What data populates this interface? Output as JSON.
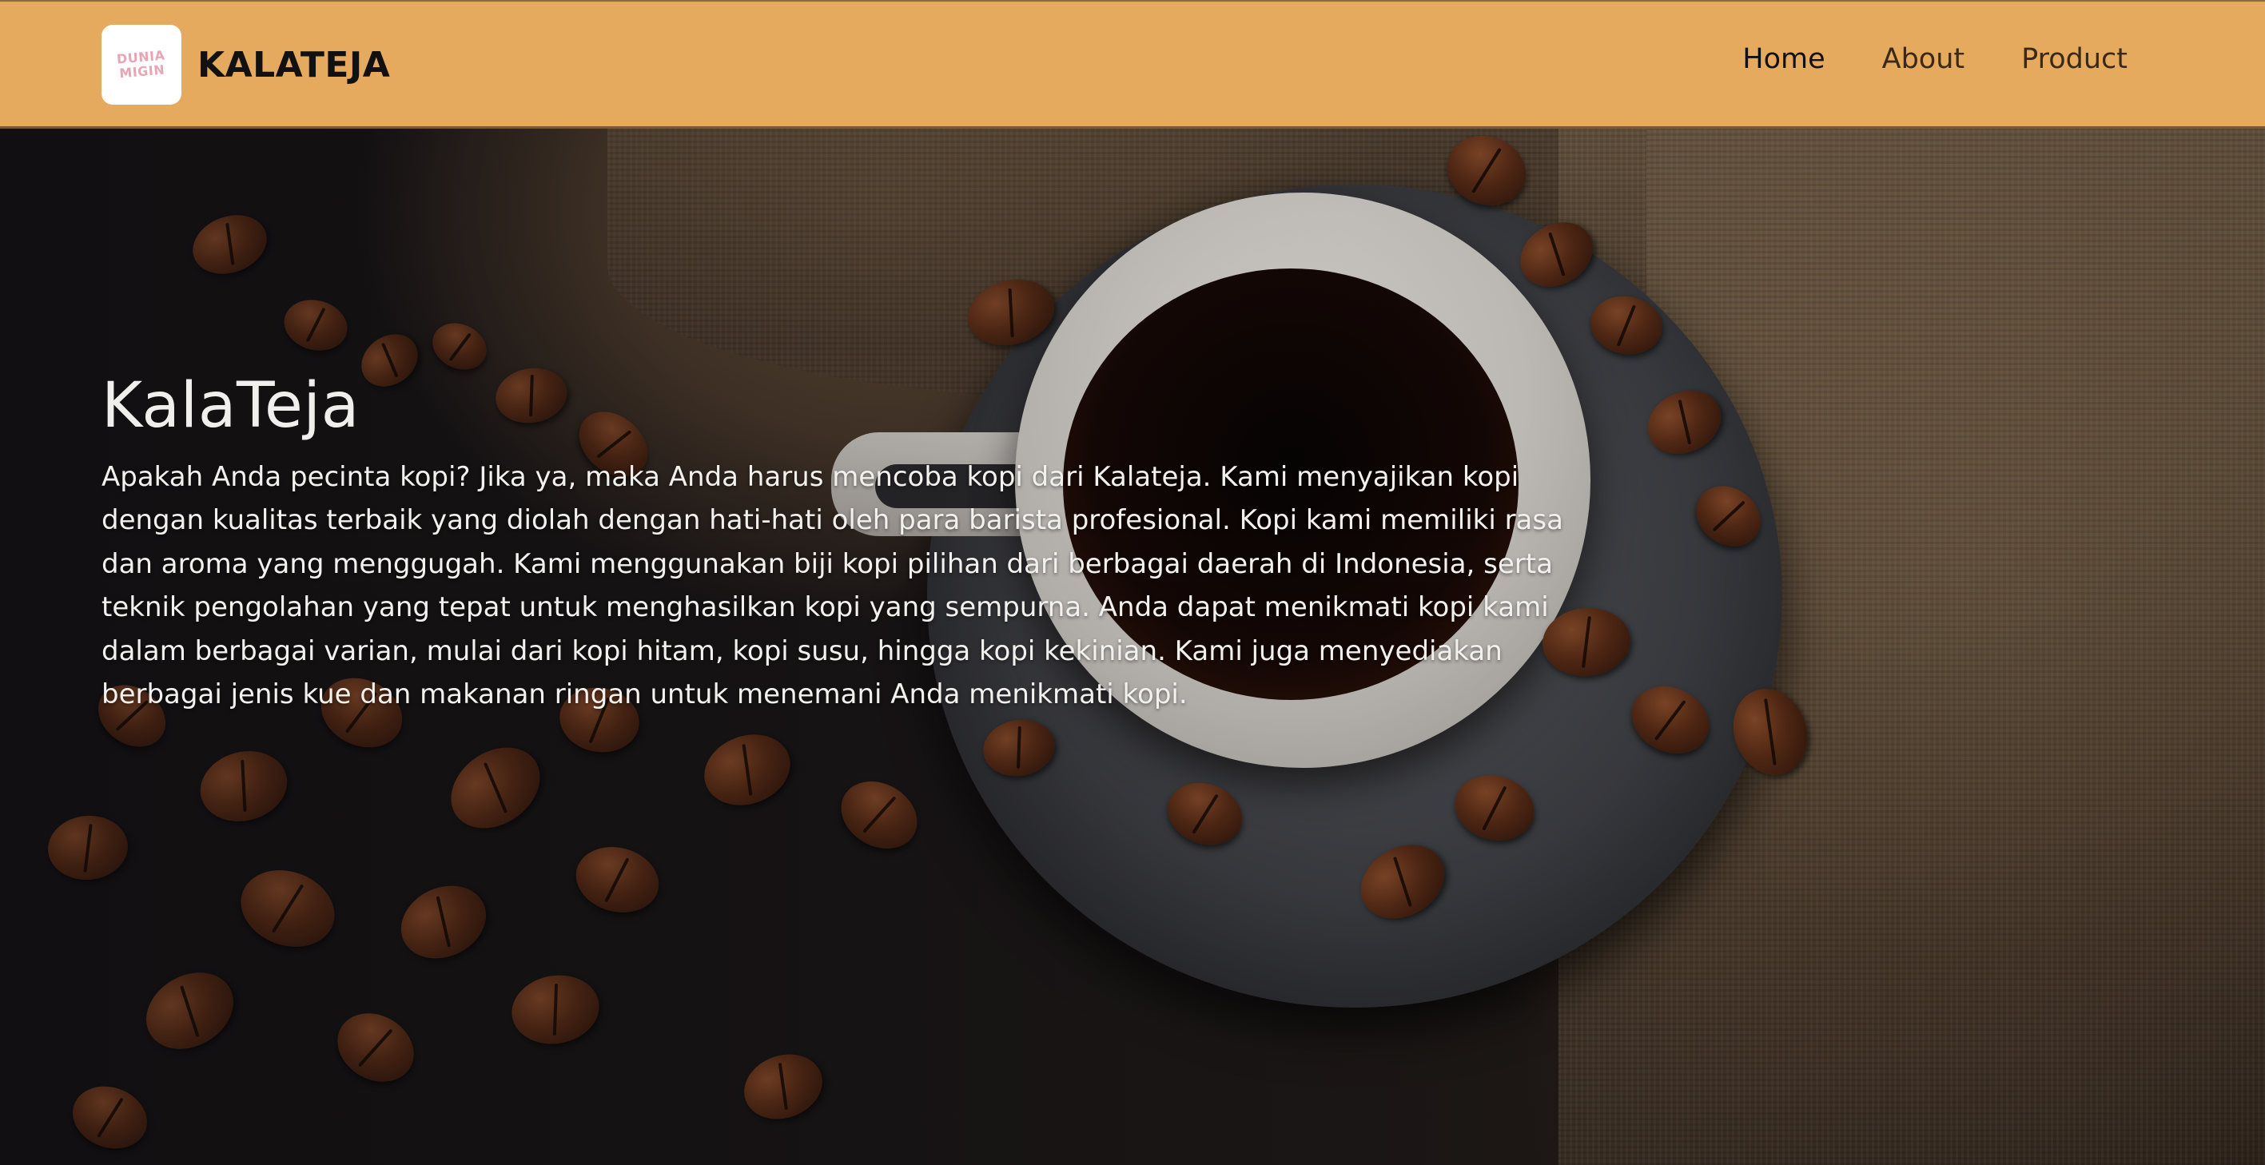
{
  "brand": {
    "logo_text": "DUNIA MIGIN",
    "name": "KALATEJA"
  },
  "nav": {
    "items": [
      {
        "label": "Home",
        "active": true
      },
      {
        "label": "About",
        "active": false
      },
      {
        "label": "Product",
        "active": false
      }
    ]
  },
  "hero": {
    "title": "KalaTeja",
    "description": "Apakah Anda pecinta kopi? Jika ya, maka Anda harus mencoba kopi dari Kalateja. Kami menyajikan kopi dengan kualitas terbaik yang diolah dengan hati-hati oleh para barista profesional. Kopi kami memiliki rasa dan aroma yang menggugah. Kami menggunakan biji kopi pilihan dari berbagai daerah di Indonesia, serta teknik pengolahan yang tepat untuk menghasilkan kopi yang sempurna. Anda dapat menikmati kopi kami dalam berbagai varian, mulai dari kopi hitam, kopi susu, hingga kopi kekinian. Kami juga menyediakan berbagai jenis kue dan makanan ringan untuk menemani Anda menikmati kopi."
  },
  "colors": {
    "header_bg": "#e6aa5f",
    "hero_text": "#f3f1ee",
    "nav_text": "#3a2a15"
  }
}
